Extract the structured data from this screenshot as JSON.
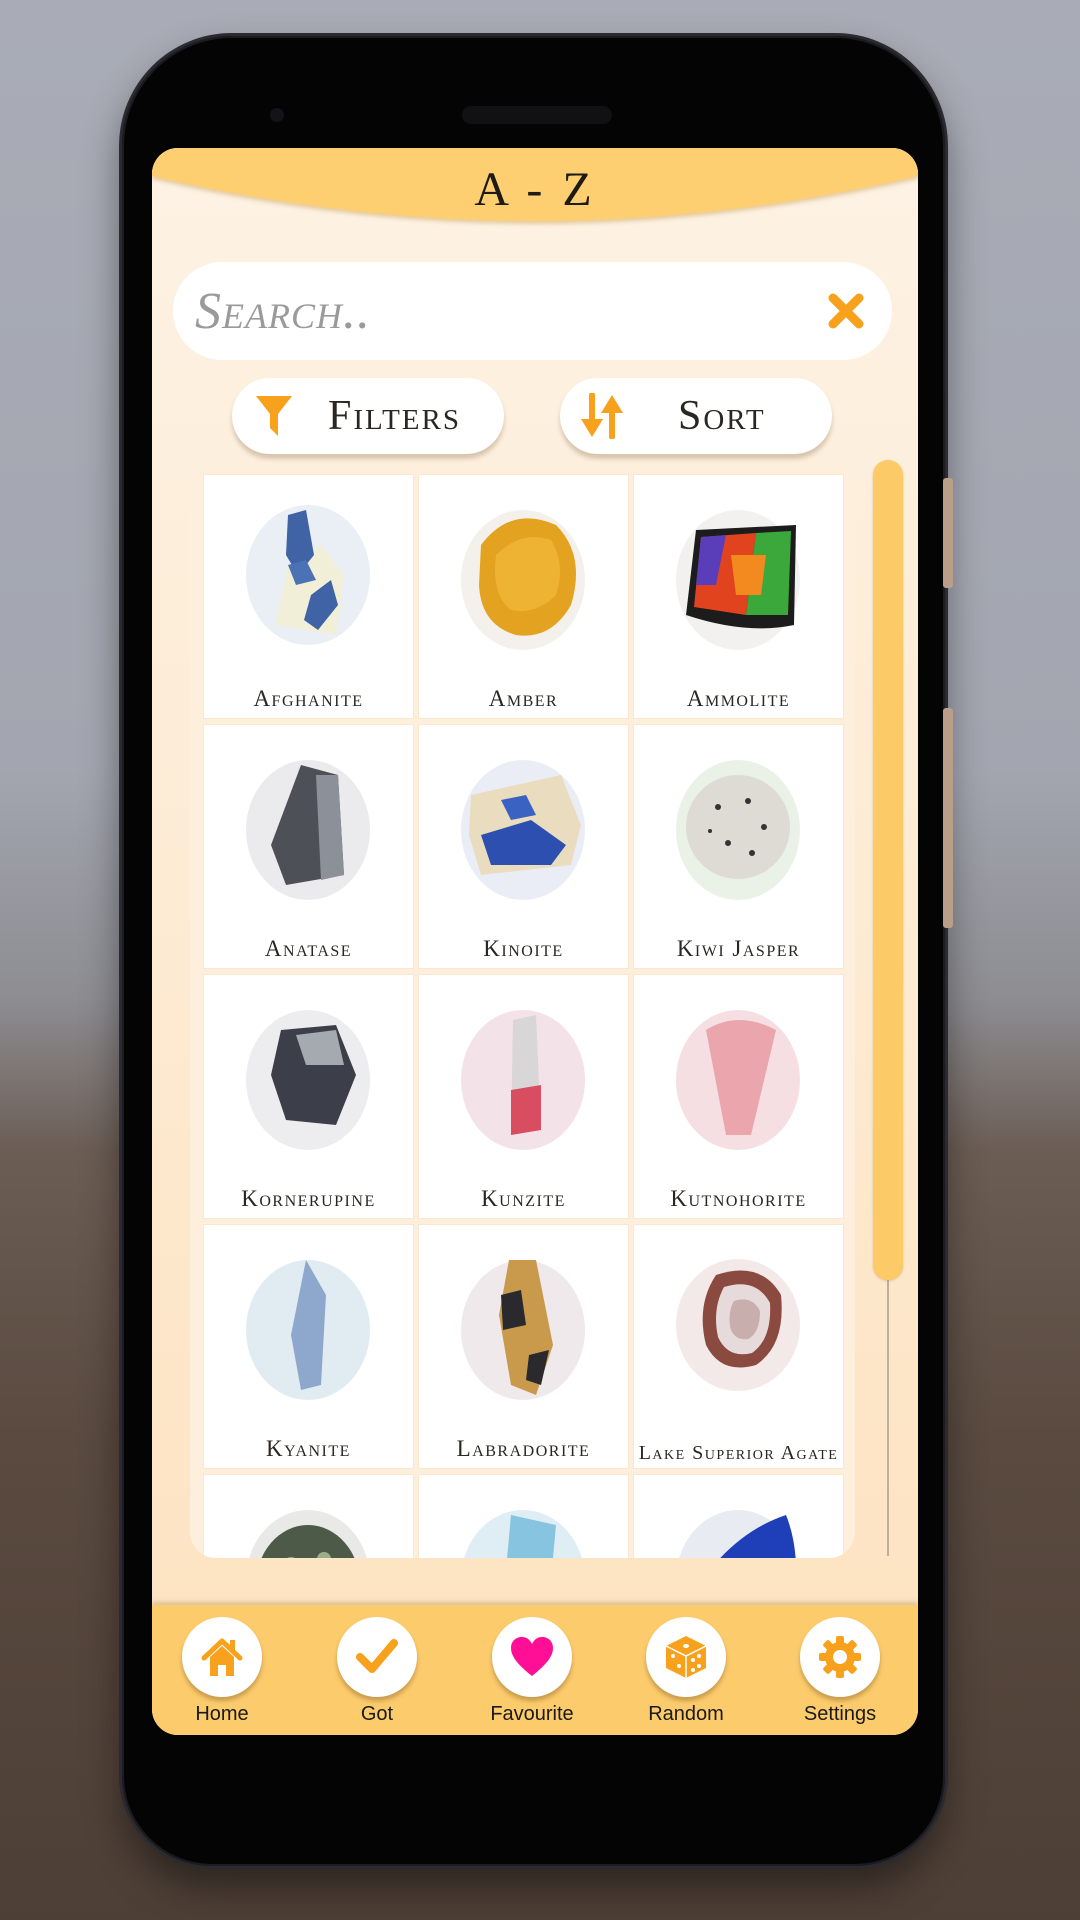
{
  "header": {
    "title": "A - Z"
  },
  "search": {
    "placeholder": "Search..",
    "value": "",
    "clear_icon": "close-icon"
  },
  "toolbar": {
    "filters_label": "Filters",
    "filters_icon": "funnel-icon",
    "sort_label": "Sort",
    "sort_icon": "sort-arrows-icon"
  },
  "colors": {
    "accent": "#fccb6c",
    "icon_orange": "#f7a11c",
    "favourite_pink": "#ff0f96",
    "screen_bg": "#fdf1e2",
    "text_dark": "#2a2622"
  },
  "gems": [
    {
      "name": "Afghanite"
    },
    {
      "name": "Amber"
    },
    {
      "name": "Ammolite"
    },
    {
      "name": "Anatase"
    },
    {
      "name": "Kinoite"
    },
    {
      "name": "Kiwi Jasper"
    },
    {
      "name": "Kornerupine"
    },
    {
      "name": "Kunzite"
    },
    {
      "name": "Kutnohorite"
    },
    {
      "name": "Kyanite"
    },
    {
      "name": "Labradorite"
    },
    {
      "name": "Lake Superior Agate"
    },
    {
      "name": ""
    },
    {
      "name": ""
    },
    {
      "name": ""
    }
  ],
  "scroll": {
    "position_fraction": 0.0,
    "visible_fraction": 0.75
  },
  "nav": [
    {
      "label": "Home",
      "icon": "home-icon",
      "active": true
    },
    {
      "label": "Got",
      "icon": "checkmark-icon",
      "active": false
    },
    {
      "label": "Favourite",
      "icon": "heart-icon",
      "active": false
    },
    {
      "label": "Random",
      "icon": "dice-icon",
      "active": false
    },
    {
      "label": "Settings",
      "icon": "gear-icon",
      "active": false
    }
  ]
}
